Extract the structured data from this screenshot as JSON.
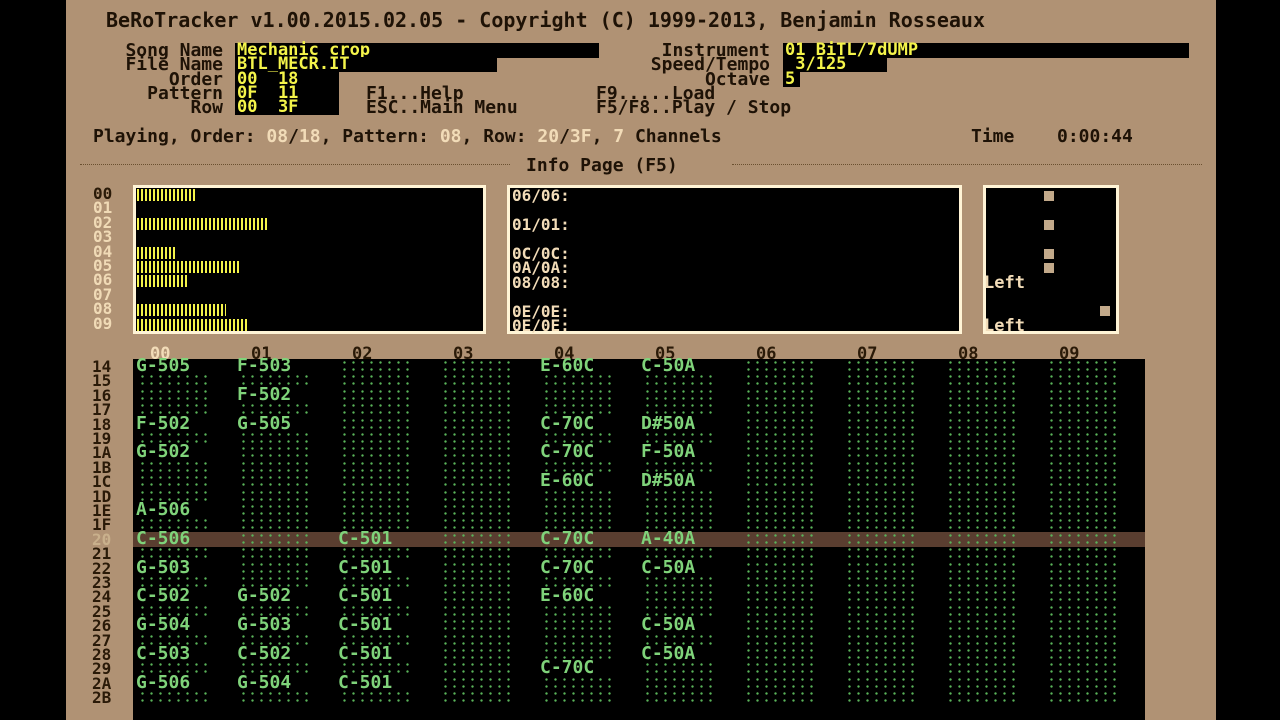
{
  "title_bar": "BeRoTracker v1.00.2015.02.05 - Copyright (C) 1999-2013, Benjamin Rosseaux",
  "labels": {
    "song_name": "Song Name",
    "file_name": "File Name",
    "order": "Order",
    "pattern": "Pattern",
    "row": "Row",
    "instrument": "Instrument",
    "speed_tempo": "Speed/Tempo",
    "octave": "Octave"
  },
  "fields": {
    "song_name": "Mechanic crop",
    "file_name": "BTL_MECR.IT",
    "order": "00  18",
    "pattern": "0F  11",
    "row": "00  3F",
    "instrument": "01 BiTL/7dUMP",
    "speed_tempo": " 3/125",
    "octave": "5"
  },
  "shortcuts": {
    "f1": "F1...Help",
    "esc": "ESC..Main Menu",
    "f9": "F9.....Load",
    "f5f8": "F5/F8..Play / Stop"
  },
  "status": {
    "prefix": "Playing, Order: ",
    "order_cur": "08",
    "slash1": "/",
    "order_total": "18",
    "pattern_label": ", Pattern: ",
    "pattern": "08",
    "row_label": ", Row: ",
    "row_cur": "20",
    "slash2": "/",
    "row_total": "3F",
    "sep": ", ",
    "channels": "7",
    "channels_label": " Channels",
    "time_label": "Time",
    "time": "0:00:44"
  },
  "info_page_title": "Info Page (F5)",
  "channel_levels": {
    "numbers": [
      "00",
      "01",
      "02",
      "03",
      "04",
      "05",
      "06",
      "07",
      "08",
      "09"
    ],
    "levels": [
      0.25,
      0,
      0.55,
      0,
      0.16,
      0.43,
      0.21,
      0,
      0.37,
      0.46
    ]
  },
  "sample_lines": [
    "06/06:",
    "01/01:",
    "0C/0C:",
    "0A/0A:",
    "08/08:",
    "0E/0E:",
    "0E/0E:"
  ],
  "pan_labels": [
    "Left",
    "Left"
  ],
  "pattern": {
    "channel_headers": [
      "00",
      "01",
      "02",
      "03",
      "04",
      "05",
      "06",
      "07",
      "08",
      "09"
    ],
    "row_numbers": [
      "14",
      "15",
      "16",
      "17",
      "18",
      "19",
      "1A",
      "1B",
      "1C",
      "1D",
      "1E",
      "1F",
      "20",
      "21",
      "22",
      "23",
      "24",
      "25",
      "26",
      "27",
      "28",
      "29",
      "2A",
      "2B"
    ],
    "current_row": "20",
    "notes": [
      [
        "G-505",
        "F-503",
        "",
        "",
        "E-60C",
        "C-50A"
      ],
      [
        "",
        "",
        "",
        "",
        "",
        ""
      ],
      [
        "",
        "F-502",
        "",
        "",
        "",
        ""
      ],
      [
        "",
        "",
        "",
        "",
        "",
        ""
      ],
      [
        "F-502",
        "G-505",
        "",
        "",
        "C-70C",
        "D#50A"
      ],
      [
        "",
        "",
        "",
        "",
        "",
        ""
      ],
      [
        "G-502",
        "",
        "",
        "",
        "C-70C",
        "F-50A"
      ],
      [
        "",
        "",
        "",
        "",
        "",
        ""
      ],
      [
        "",
        "",
        "",
        "",
        "E-60C",
        "D#50A"
      ],
      [
        "",
        "",
        "",
        "",
        "",
        ""
      ],
      [
        "A-506",
        "",
        "",
        "",
        "",
        ""
      ],
      [
        "",
        "",
        "",
        "",
        "",
        ""
      ],
      [
        "C-506",
        "",
        "C-501",
        "",
        "C-70C",
        "A-40A"
      ],
      [
        "",
        "",
        "",
        "",
        "",
        ""
      ],
      [
        "G-503",
        "",
        "C-501",
        "",
        "C-70C",
        "C-50A"
      ],
      [
        "",
        "",
        "",
        "",
        "",
        ""
      ],
      [
        "C-502",
        "G-502",
        "C-501",
        "",
        "E-60C",
        ""
      ],
      [
        "",
        "",
        "",
        "",
        "",
        ""
      ],
      [
        "G-504",
        "G-503",
        "C-501",
        "",
        "",
        "C-50A"
      ],
      [
        "",
        "",
        "",
        "",
        "",
        ""
      ],
      [
        "C-503",
        "C-502",
        "C-501",
        "",
        "",
        "C-50A"
      ],
      [
        "",
        "",
        "",
        "",
        "C-70C",
        ""
      ],
      [
        "G-506",
        "G-504",
        "C-501",
        "",
        "",
        ""
      ],
      [
        "",
        "",
        "",
        "",
        "",
        ""
      ]
    ]
  }
}
